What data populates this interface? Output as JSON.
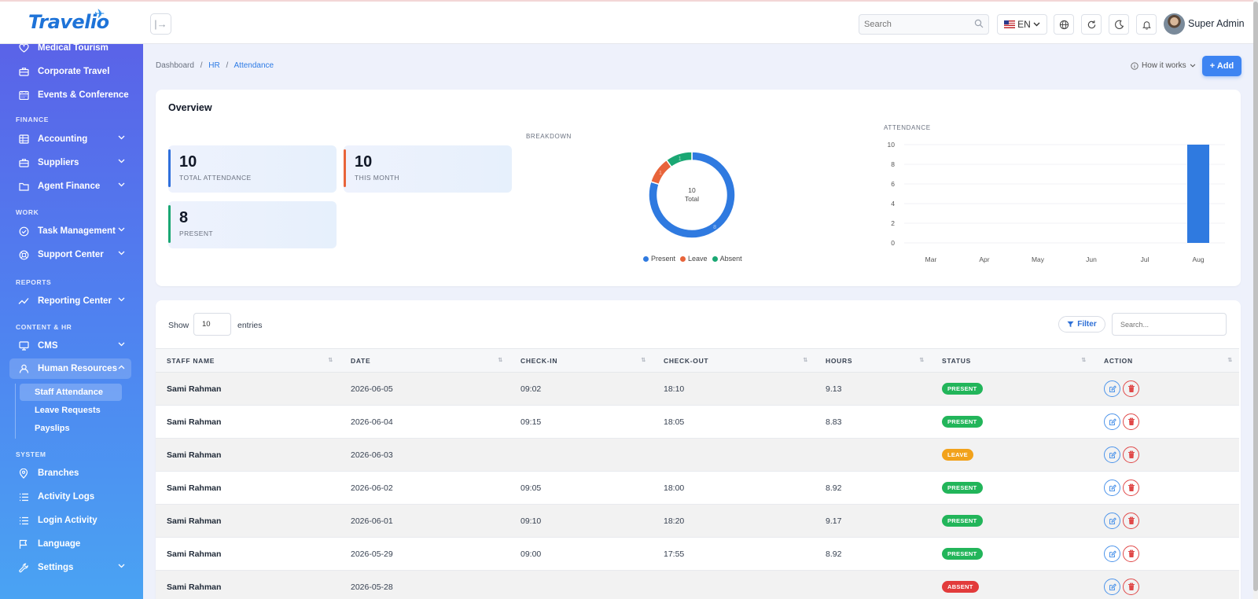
{
  "app": {
    "logo_text": "Travelio"
  },
  "topbar": {
    "search_placeholder": "Search",
    "language": "EN",
    "user_name": "Super Admin"
  },
  "sidebar": {
    "items_top": [
      {
        "label": "Medical Tourism",
        "icon": "heart-icon"
      },
      {
        "label": "Corporate Travel",
        "icon": "briefcase-icon"
      },
      {
        "label": "Events & Conference",
        "icon": "calendar-icon"
      }
    ],
    "sections": {
      "finance": "FINANCE",
      "work": "WORK",
      "reports": "REPORTS",
      "content_hr": "CONTENT & HR",
      "system": "SYSTEM"
    },
    "finance_items": [
      {
        "label": "Accounting",
        "icon": "ledger-icon"
      },
      {
        "label": "Suppliers",
        "icon": "briefcase-icon"
      },
      {
        "label": "Agent Finance",
        "icon": "folder-icon"
      }
    ],
    "work_items": [
      {
        "label": "Task Management",
        "icon": "check-circle-icon"
      },
      {
        "label": "Support Center",
        "icon": "lifebuoy-icon"
      }
    ],
    "report_items": [
      {
        "label": "Reporting Center",
        "icon": "trend-icon"
      }
    ],
    "content_items": [
      {
        "label": "CMS",
        "icon": "monitor-icon"
      },
      {
        "label": "Human Resources",
        "icon": "users-icon"
      }
    ],
    "hr_sub": [
      {
        "label": "Staff Attendance"
      },
      {
        "label": "Leave Requests"
      },
      {
        "label": "Payslips"
      }
    ],
    "system_items": [
      {
        "label": "Branches",
        "icon": "pin-icon"
      },
      {
        "label": "Activity Logs",
        "icon": "list-icon"
      },
      {
        "label": "Login Activity",
        "icon": "list-icon"
      },
      {
        "label": "Language",
        "icon": "flag-icon"
      },
      {
        "label": "Settings",
        "icon": "wrench-icon"
      }
    ]
  },
  "breadcrumb": {
    "root": "Dashboard",
    "mid": "HR",
    "current": "Attendance"
  },
  "page_actions": {
    "how_it_works": "How it works",
    "add": "+ Add"
  },
  "overview": {
    "title": "Overview",
    "stats": [
      {
        "value": "10",
        "label": "TOTAL ATTENDANCE",
        "color": "#2f6fdc"
      },
      {
        "value": "10",
        "label": "THIS MONTH",
        "color": "#e8643a"
      },
      {
        "value": "8",
        "label": "PRESENT",
        "color": "#1aa773"
      }
    ],
    "breakdown_label": "BREAKDOWN",
    "attendance_label": "ATTENDANCE"
  },
  "chart_data": [
    {
      "type": "pie",
      "title": "BREAKDOWN",
      "categories": [
        "Present",
        "Leave",
        "Absent"
      ],
      "values": [
        8,
        1,
        1
      ],
      "colors": [
        "#2f7ae0",
        "#e8643a",
        "#1aa773"
      ],
      "center_value": "10",
      "center_label": "Total",
      "legend": "bottom"
    },
    {
      "type": "bar",
      "title": "ATTENDANCE",
      "categories": [
        "Mar",
        "Apr",
        "May",
        "Jun",
        "Jul",
        "Aug"
      ],
      "values": [
        0,
        0,
        0,
        0,
        0,
        10
      ],
      "ylim": [
        0,
        10
      ],
      "yticks": [
        "0",
        "2",
        "4",
        "6",
        "8",
        "10"
      ],
      "color": "#2f7ae0",
      "grid": true
    }
  ],
  "table": {
    "show_label": "Show",
    "entries_value": "10",
    "entries_label": "entries",
    "filter_label": "Filter",
    "search_placeholder": "Search...",
    "columns": [
      "STAFF NAME",
      "DATE",
      "CHECK-IN",
      "CHECK-OUT",
      "HOURS",
      "STATUS",
      "ACTION"
    ],
    "rows": [
      {
        "name": "Sami Rahman",
        "date": "2026-06-05",
        "check_in": "09:02",
        "check_out": "18:10",
        "hours": "9.13",
        "status": "PRESENT",
        "status_color": "#22b55a"
      },
      {
        "name": "Sami Rahman",
        "date": "2026-06-04",
        "check_in": "09:15",
        "check_out": "18:05",
        "hours": "8.83",
        "status": "PRESENT",
        "status_color": "#22b55a"
      },
      {
        "name": "Sami Rahman",
        "date": "2026-06-03",
        "check_in": "",
        "check_out": "",
        "hours": "",
        "status": "LEAVE",
        "status_color": "#f2a21b"
      },
      {
        "name": "Sami Rahman",
        "date": "2026-06-02",
        "check_in": "09:05",
        "check_out": "18:00",
        "hours": "8.92",
        "status": "PRESENT",
        "status_color": "#22b55a"
      },
      {
        "name": "Sami Rahman",
        "date": "2026-06-01",
        "check_in": "09:10",
        "check_out": "18:20",
        "hours": "9.17",
        "status": "PRESENT",
        "status_color": "#22b55a"
      },
      {
        "name": "Sami Rahman",
        "date": "2026-05-29",
        "check_in": "09:00",
        "check_out": "17:55",
        "hours": "8.92",
        "status": "PRESENT",
        "status_color": "#22b55a"
      },
      {
        "name": "Sami Rahman",
        "date": "2026-05-28",
        "check_in": "",
        "check_out": "",
        "hours": "",
        "status": "ABSENT",
        "status_color": "#e23b3b"
      }
    ]
  }
}
